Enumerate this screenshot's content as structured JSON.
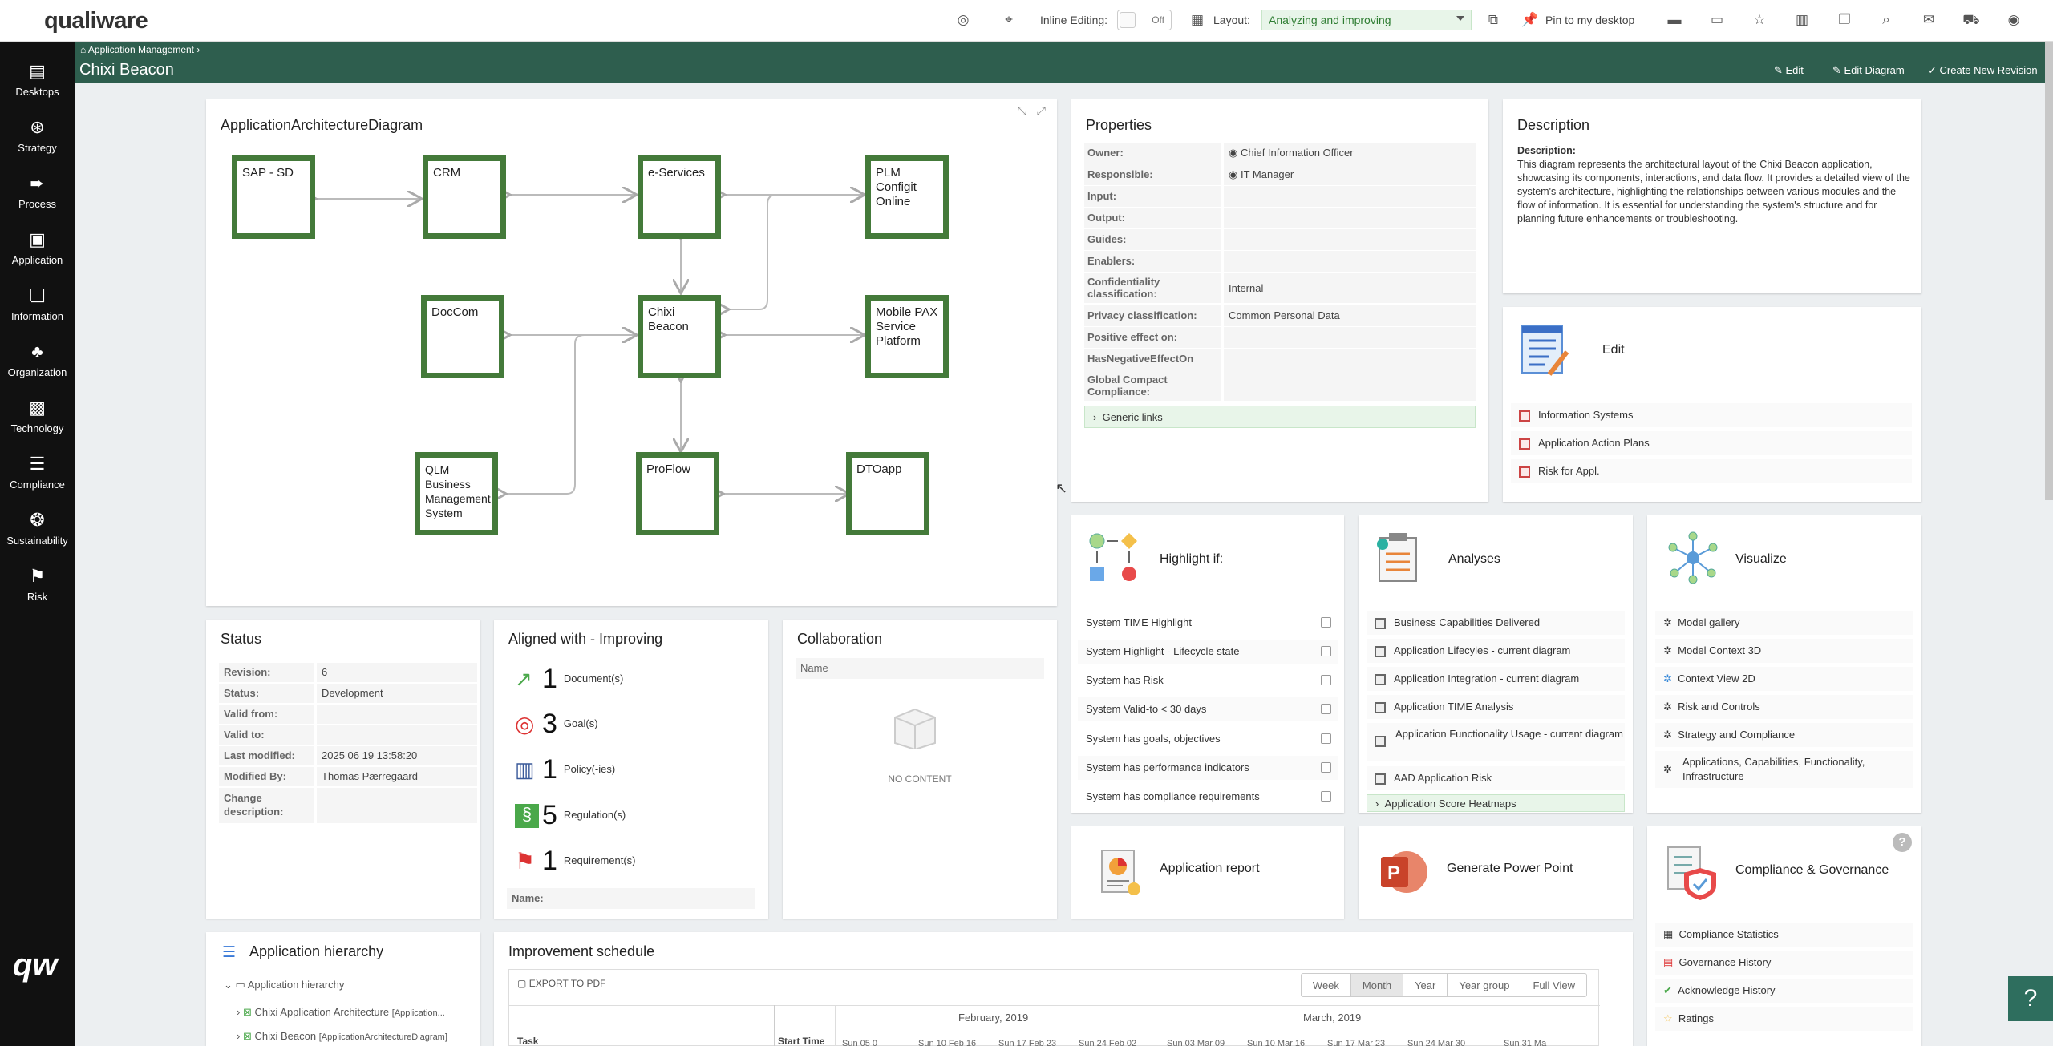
{
  "app": {
    "logo": "qualiware"
  },
  "topbar": {
    "inline_label": "Inline Editing:",
    "inline_state": "Off",
    "layout_label": "Layout:",
    "layout_value": "Analyzing and improving",
    "pin_label": "Pin to my desktop"
  },
  "sidebar": {
    "items": [
      {
        "label": "Desktops",
        "icon": "desktops-icon"
      },
      {
        "label": "Strategy",
        "icon": "strategy-icon"
      },
      {
        "label": "Process",
        "icon": "process-icon"
      },
      {
        "label": "Application",
        "icon": "application-icon"
      },
      {
        "label": "Information",
        "icon": "information-icon"
      },
      {
        "label": "Organization",
        "icon": "organization-icon"
      },
      {
        "label": "Technology",
        "icon": "technology-icon"
      },
      {
        "label": "Compliance",
        "icon": "compliance-icon"
      },
      {
        "label": "Sustainability",
        "icon": "sustainability-icon"
      },
      {
        "label": "Risk",
        "icon": "risk-icon"
      }
    ],
    "footer_logo": "qw"
  },
  "header": {
    "breadcrumb": "Application Management",
    "title": "Chixi Beacon",
    "edit": "Edit",
    "edit_diagram": "Edit Diagram",
    "create_revision": "Create New Revision"
  },
  "diagram": {
    "title": "ApplicationArchitectureDiagram",
    "boxes": [
      "SAP - SD",
      "CRM",
      "e-Services",
      "PLM Configit Online",
      "DocCom",
      "Chixi Beacon",
      "Mobile PAX Service Platform",
      "QLM Business Management System",
      "ProFlow",
      "DTOapp"
    ]
  },
  "properties": {
    "title": "Properties",
    "rows": [
      {
        "k": "Owner:",
        "v": "Chief Information Officer"
      },
      {
        "k": "Responsible:",
        "v": "IT Manager"
      },
      {
        "k": "Input:",
        "v": ""
      },
      {
        "k": "Output:",
        "v": ""
      },
      {
        "k": "Guides:",
        "v": ""
      },
      {
        "k": "Enablers:",
        "v": ""
      },
      {
        "k": "Confidentiality classification:",
        "v": "Internal"
      },
      {
        "k": "Privacy classification:",
        "v": "Common Personal Data"
      },
      {
        "k": "Positive effect on:",
        "v": ""
      },
      {
        "k": "HasNegativeEffectOn",
        "v": ""
      },
      {
        "k": "Global Compact Compliance:",
        "v": ""
      }
    ],
    "generic_links": "Generic links"
  },
  "description": {
    "title": "Description",
    "label": "Description:",
    "text": "This diagram represents the architectural layout of the Chixi Beacon application, showcasing its components, interactions, and data flow. It provides a detailed view of the system's architecture, highlighting the relationships between various modules and the flow of information. It is essential for understanding the system's structure and for planning future enhancements or troubleshooting."
  },
  "edit_panel": {
    "title": "Edit",
    "items": [
      "Information Systems",
      "Application Action Plans",
      "Risk for Appl."
    ]
  },
  "highlight": {
    "title": "Highlight if:",
    "items": [
      "System TIME Highlight",
      "System Highlight - Lifecycle state",
      "System has Risk",
      "System Valid-to < 30 days",
      "System has goals, objectives",
      "System has performance indicators",
      "System has compliance requirements"
    ]
  },
  "analyses": {
    "title": "Analyses",
    "items": [
      "Business Capabilities Delivered",
      "Application Lifecyles - current diagram",
      "Application Integration - current diagram",
      "Application TIME Analysis",
      "Application Functionality Usage - current diagram",
      "AAD Application Risk"
    ],
    "group": "Application Score Heatmaps"
  },
  "visualize": {
    "title": "Visualize",
    "items": [
      "Model gallery",
      "Model Context 3D",
      "Context View 2D",
      "Risk and Controls",
      "Strategy and Compliance",
      "Applications, Capabilities, Functionality, Infrastructure"
    ]
  },
  "status": {
    "title": "Status",
    "rows": [
      {
        "k": "Revision:",
        "v": "6"
      },
      {
        "k": "Status:",
        "v": "Development"
      },
      {
        "k": "Valid from:",
        "v": ""
      },
      {
        "k": "Valid to:",
        "v": ""
      },
      {
        "k": "Last modified:",
        "v": "2025 06 19 13:58:20"
      },
      {
        "k": "Modified By:",
        "v": "Thomas Pærregaard"
      },
      {
        "k": "Change description:",
        "v": ""
      }
    ]
  },
  "aligned": {
    "title": "Aligned with - Improving",
    "items": [
      {
        "n": "1",
        "label": "Document(s)"
      },
      {
        "n": "3",
        "label": "Goal(s)"
      },
      {
        "n": "1",
        "label": "Policy(-ies)"
      },
      {
        "n": "5",
        "label": "Regulation(s)"
      },
      {
        "n": "1",
        "label": "Requirement(s)"
      }
    ],
    "name_label": "Name:"
  },
  "collaboration": {
    "title": "Collaboration",
    "col": "Name",
    "empty": "NO CONTENT"
  },
  "app_report": {
    "title": "Application report"
  },
  "power_point": {
    "title": "Generate Power Point"
  },
  "compliance": {
    "title": "Compliance & Governance",
    "items": [
      "Compliance Statistics",
      "Governance History",
      "Acknowledge History",
      "Ratings"
    ]
  },
  "hierarchy": {
    "title": "Application hierarchy",
    "root": "Application hierarchy",
    "items": [
      {
        "name": "Chixi Application Architecture",
        "type": "[Application..."
      },
      {
        "name": "Chixi Beacon",
        "type": "[ApplicationArchitectureDiagram]"
      }
    ]
  },
  "schedule": {
    "title": "Improvement schedule",
    "export": "EXPORT TO PDF",
    "views": [
      "Week",
      "Month",
      "Year",
      "Year group",
      "Full View"
    ],
    "months": [
      "February, 2019",
      "March, 2019"
    ],
    "col_task": "Task",
    "col_start": "Start Time",
    "weeks": [
      "Sun 05 0",
      "Sun 10 Feb 16",
      "Sun 17 Feb 23",
      "Sun 24 Feb 02",
      "Sun 03 Mar 09",
      "Sun 10 Mar 16",
      "Sun 17 Mar 23",
      "Sun 24 Mar 30",
      "Sun 31 Ma"
    ]
  }
}
